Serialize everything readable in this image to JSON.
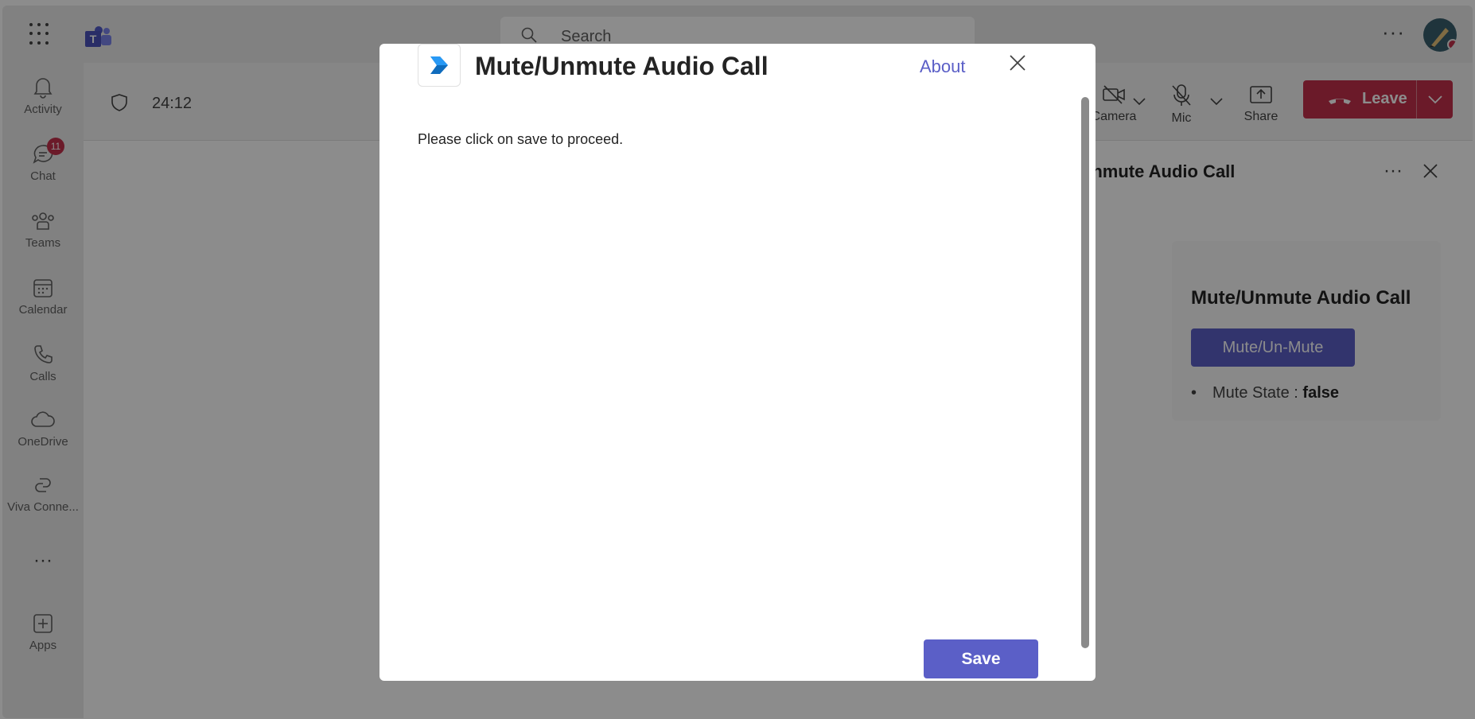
{
  "header": {
    "search_placeholder": "Search",
    "more_label": "···"
  },
  "rail": {
    "items": [
      {
        "label": "Activity",
        "icon": "bell-icon"
      },
      {
        "label": "Chat",
        "icon": "chat-icon",
        "badge": "11"
      },
      {
        "label": "Teams",
        "icon": "teams-icon"
      },
      {
        "label": "Calendar",
        "icon": "calendar-icon"
      },
      {
        "label": "Calls",
        "icon": "phone-icon"
      },
      {
        "label": "OneDrive",
        "icon": "cloud-icon"
      },
      {
        "label": "Viva Conne...",
        "icon": "viva-icon"
      },
      {
        "label": "Apps",
        "icon": "add-app-icon"
      }
    ],
    "more_label": "···"
  },
  "call": {
    "timer": "24:12",
    "camera_label": "Camera",
    "mic_label": "Mic",
    "share_label": "Share",
    "leave_label": "Leave",
    "leave_color": "#c4314b"
  },
  "side_panel": {
    "title": "Mute/Unmute Audio Call",
    "more_label": "···",
    "card_title": "Mute/Unmute Audio Call",
    "button_label": "Mute/Un-Mute",
    "state_label": "Mute State : ",
    "state_value": "false"
  },
  "dialog": {
    "title": "Mute/Unmute Audio Call",
    "about_label": "About",
    "message": "Please click on save to proceed.",
    "save_label": "Save",
    "accent_color": "#5b5fc7"
  }
}
